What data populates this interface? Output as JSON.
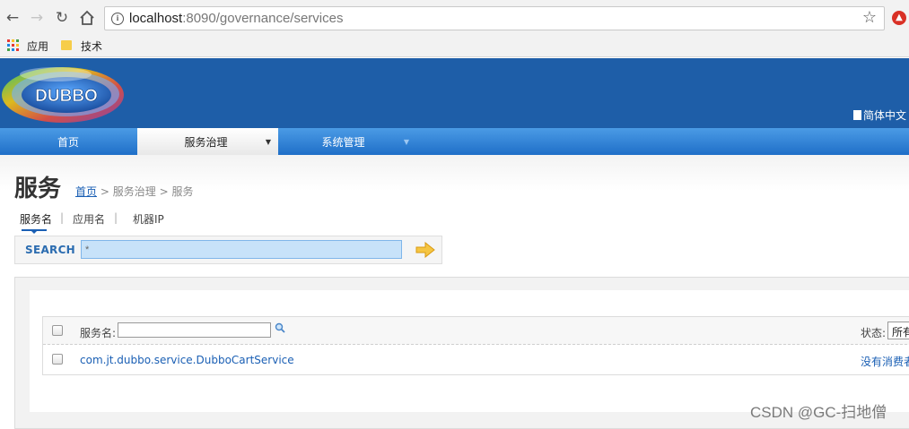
{
  "browser": {
    "url_host": "localhost",
    "url_path": ":8090/governance/services",
    "bookmarks": [
      {
        "label": "应用",
        "icon": "apps-grid-icon"
      },
      {
        "label": "技术",
        "icon": "folder-icon"
      }
    ]
  },
  "header": {
    "logo_text": "DUBBO",
    "language_label": "简体中文"
  },
  "menu": {
    "items": [
      {
        "label": "首页"
      },
      {
        "label": "服务治理",
        "arrow": "▼",
        "active": true
      },
      {
        "label": "系统管理",
        "arrow": "▼"
      }
    ]
  },
  "page": {
    "title": "服务",
    "breadcrumb": {
      "home": "首页",
      "separator": ">",
      "section": "服务治理",
      "current": "服务"
    }
  },
  "search": {
    "tabs": [
      {
        "label": "服务名",
        "active": true
      },
      {
        "label": "应用名"
      },
      {
        "label": "机器IP"
      }
    ],
    "tab_separator": "|",
    "label": "SEARCH",
    "value": "*"
  },
  "grid": {
    "column_label": "服务名:",
    "status_label": "状态:",
    "status_value": "所有",
    "rows": [
      {
        "service": "com.jt.dubbo.service.DubboCartService",
        "status": "没有消费者"
      }
    ]
  },
  "watermark": "CSDN @GC-扫地僧",
  "colors": {
    "header_bg": "#1e5ea8",
    "menu_bg": "#2a7fd4",
    "link": "#1a5fb4"
  }
}
